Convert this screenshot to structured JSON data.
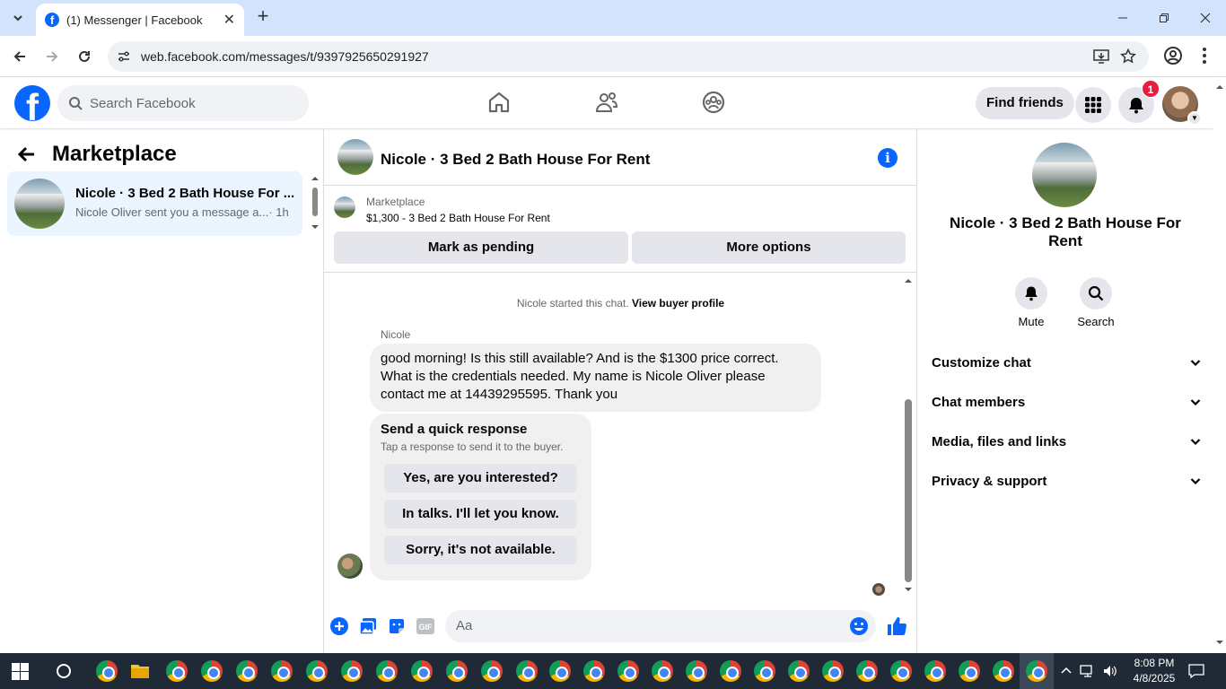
{
  "browser": {
    "tab_title": "(1) Messenger | Facebook",
    "url": "web.facebook.com/messages/t/9397925650291927"
  },
  "header": {
    "search_placeholder": "Search Facebook",
    "find_friends": "Find friends",
    "notification_count": "1"
  },
  "sidebar": {
    "title": "Marketplace",
    "conversations": [
      {
        "title": "Nicole · 3 Bed 2 Bath House For ...",
        "preview": "Nicole Oliver sent you a message a...",
        "time": "· 1h"
      }
    ]
  },
  "chat": {
    "title": "Nicole · 3 Bed 2 Bath House For Rent",
    "listing": {
      "source": "Marketplace",
      "price_title": "$1,300 - 3 Bed 2 Bath House For Rent",
      "mark_pending": "Mark as pending",
      "more_options": "More options"
    },
    "system_message": "Nicole started this chat.",
    "view_buyer_profile": "View buyer profile",
    "sender": "Nicole",
    "message": "good morning! Is this still available? And is the $1300 price correct. What is the credentials needed. My name is Nicole Oliver please contact me at 14439295595. Thank you",
    "quick_response": {
      "title": "Send a quick response",
      "subtitle": "Tap a response to send it to the buyer.",
      "options": [
        "Yes, are you interested?",
        "In talks. I'll let you know.",
        "Sorry, it's not available."
      ]
    },
    "composer_placeholder": "Aa"
  },
  "details": {
    "name": "Nicole · 3 Bed 2 Bath House For Rent",
    "actions": [
      "Mute",
      "Search"
    ],
    "sections": [
      "Customize chat",
      "Chat members",
      "Media, files and links",
      "Privacy & support"
    ]
  },
  "taskbar": {
    "time": "8:08 PM",
    "date": "4/8/2025"
  },
  "colors": {
    "accent": "#0866ff",
    "selected_bg": "#ebf5ff",
    "badge": "#e41e3f",
    "taskbar": "#1f2a36"
  }
}
